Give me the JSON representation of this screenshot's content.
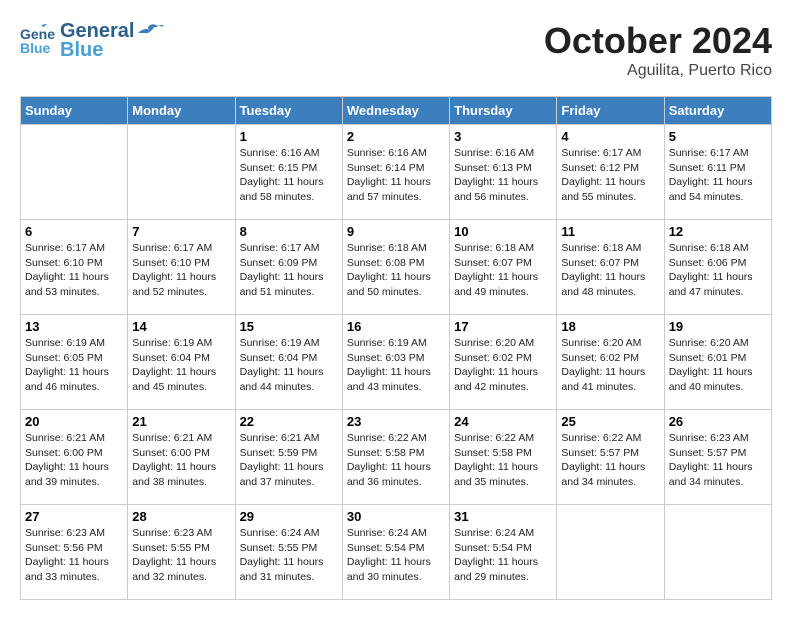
{
  "header": {
    "logo_general": "General",
    "logo_blue": "Blue",
    "month": "October 2024",
    "location": "Aguilita, Puerto Rico"
  },
  "weekdays": [
    "Sunday",
    "Monday",
    "Tuesday",
    "Wednesday",
    "Thursday",
    "Friday",
    "Saturday"
  ],
  "weeks": [
    [
      {
        "day": "",
        "info": ""
      },
      {
        "day": "",
        "info": ""
      },
      {
        "day": "1",
        "sunrise": "6:16 AM",
        "sunset": "6:15 PM",
        "daylight": "11 hours and 58 minutes."
      },
      {
        "day": "2",
        "sunrise": "6:16 AM",
        "sunset": "6:14 PM",
        "daylight": "11 hours and 57 minutes."
      },
      {
        "day": "3",
        "sunrise": "6:16 AM",
        "sunset": "6:13 PM",
        "daylight": "11 hours and 56 minutes."
      },
      {
        "day": "4",
        "sunrise": "6:17 AM",
        "sunset": "6:12 PM",
        "daylight": "11 hours and 55 minutes."
      },
      {
        "day": "5",
        "sunrise": "6:17 AM",
        "sunset": "6:11 PM",
        "daylight": "11 hours and 54 minutes."
      }
    ],
    [
      {
        "day": "6",
        "sunrise": "6:17 AM",
        "sunset": "6:10 PM",
        "daylight": "11 hours and 53 minutes."
      },
      {
        "day": "7",
        "sunrise": "6:17 AM",
        "sunset": "6:10 PM",
        "daylight": "11 hours and 52 minutes."
      },
      {
        "day": "8",
        "sunrise": "6:17 AM",
        "sunset": "6:09 PM",
        "daylight": "11 hours and 51 minutes."
      },
      {
        "day": "9",
        "sunrise": "6:18 AM",
        "sunset": "6:08 PM",
        "daylight": "11 hours and 50 minutes."
      },
      {
        "day": "10",
        "sunrise": "6:18 AM",
        "sunset": "6:07 PM",
        "daylight": "11 hours and 49 minutes."
      },
      {
        "day": "11",
        "sunrise": "6:18 AM",
        "sunset": "6:07 PM",
        "daylight": "11 hours and 48 minutes."
      },
      {
        "day": "12",
        "sunrise": "6:18 AM",
        "sunset": "6:06 PM",
        "daylight": "11 hours and 47 minutes."
      }
    ],
    [
      {
        "day": "13",
        "sunrise": "6:19 AM",
        "sunset": "6:05 PM",
        "daylight": "11 hours and 46 minutes."
      },
      {
        "day": "14",
        "sunrise": "6:19 AM",
        "sunset": "6:04 PM",
        "daylight": "11 hours and 45 minutes."
      },
      {
        "day": "15",
        "sunrise": "6:19 AM",
        "sunset": "6:04 PM",
        "daylight": "11 hours and 44 minutes."
      },
      {
        "day": "16",
        "sunrise": "6:19 AM",
        "sunset": "6:03 PM",
        "daylight": "11 hours and 43 minutes."
      },
      {
        "day": "17",
        "sunrise": "6:20 AM",
        "sunset": "6:02 PM",
        "daylight": "11 hours and 42 minutes."
      },
      {
        "day": "18",
        "sunrise": "6:20 AM",
        "sunset": "6:02 PM",
        "daylight": "11 hours and 41 minutes."
      },
      {
        "day": "19",
        "sunrise": "6:20 AM",
        "sunset": "6:01 PM",
        "daylight": "11 hours and 40 minutes."
      }
    ],
    [
      {
        "day": "20",
        "sunrise": "6:21 AM",
        "sunset": "6:00 PM",
        "daylight": "11 hours and 39 minutes."
      },
      {
        "day": "21",
        "sunrise": "6:21 AM",
        "sunset": "6:00 PM",
        "daylight": "11 hours and 38 minutes."
      },
      {
        "day": "22",
        "sunrise": "6:21 AM",
        "sunset": "5:59 PM",
        "daylight": "11 hours and 37 minutes."
      },
      {
        "day": "23",
        "sunrise": "6:22 AM",
        "sunset": "5:58 PM",
        "daylight": "11 hours and 36 minutes."
      },
      {
        "day": "24",
        "sunrise": "6:22 AM",
        "sunset": "5:58 PM",
        "daylight": "11 hours and 35 minutes."
      },
      {
        "day": "25",
        "sunrise": "6:22 AM",
        "sunset": "5:57 PM",
        "daylight": "11 hours and 34 minutes."
      },
      {
        "day": "26",
        "sunrise": "6:23 AM",
        "sunset": "5:57 PM",
        "daylight": "11 hours and 34 minutes."
      }
    ],
    [
      {
        "day": "27",
        "sunrise": "6:23 AM",
        "sunset": "5:56 PM",
        "daylight": "11 hours and 33 minutes."
      },
      {
        "day": "28",
        "sunrise": "6:23 AM",
        "sunset": "5:55 PM",
        "daylight": "11 hours and 32 minutes."
      },
      {
        "day": "29",
        "sunrise": "6:24 AM",
        "sunset": "5:55 PM",
        "daylight": "11 hours and 31 minutes."
      },
      {
        "day": "30",
        "sunrise": "6:24 AM",
        "sunset": "5:54 PM",
        "daylight": "11 hours and 30 minutes."
      },
      {
        "day": "31",
        "sunrise": "6:24 AM",
        "sunset": "5:54 PM",
        "daylight": "11 hours and 29 minutes."
      },
      {
        "day": "",
        "info": ""
      },
      {
        "day": "",
        "info": ""
      }
    ]
  ]
}
